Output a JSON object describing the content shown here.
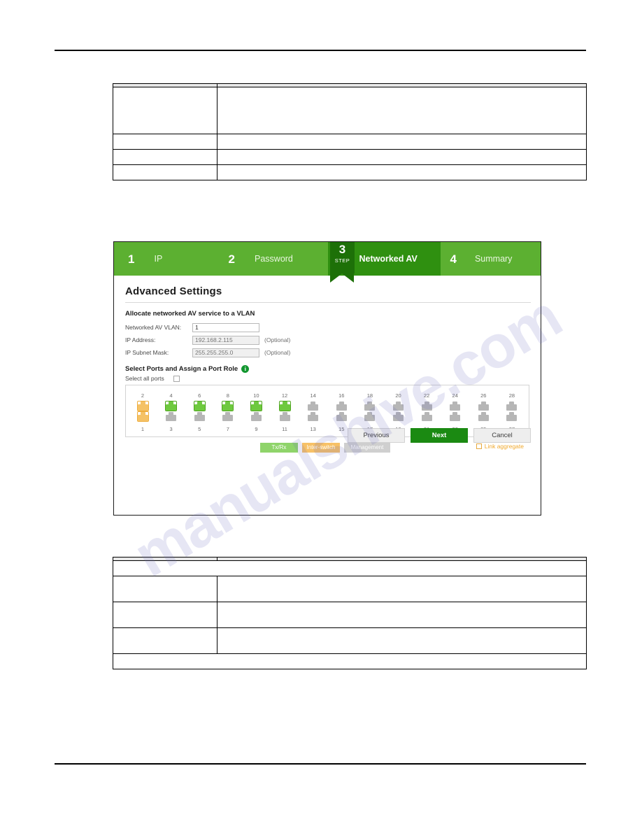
{
  "wizard": {
    "steps": [
      {
        "num": "1",
        "label": "IP",
        "active": false
      },
      {
        "num": "2",
        "label": "Password",
        "active": false
      },
      {
        "num": "3",
        "label": "Networked AV",
        "active": true
      },
      {
        "num": "4",
        "label": "Summary",
        "active": false
      }
    ],
    "pointer": {
      "num": "3",
      "word": "STEP"
    },
    "panel_title": "Advanced Settings",
    "vlan_section": {
      "heading": "Allocate networked AV service to a VLAN",
      "fields": [
        {
          "label": "Networked AV VLAN:",
          "value": "1",
          "placeholder": "",
          "disabled": false,
          "optional": ""
        },
        {
          "label": "IP Address:",
          "value": "",
          "placeholder": "192.168.2.115",
          "disabled": true,
          "optional": "(Optional)"
        },
        {
          "label": "IP Subnet Mask:",
          "value": "",
          "placeholder": "255.255.255.0",
          "disabled": true,
          "optional": "(Optional)"
        }
      ]
    },
    "ports_section": {
      "heading": "Select Ports and Assign a Port Role",
      "info_icon": "info-icon",
      "select_all_label": "Select all ports",
      "top_row_numbers": [
        "2",
        "4",
        "6",
        "8",
        "10",
        "12",
        "14",
        "16",
        "18",
        "20",
        "22",
        "24",
        "26",
        "28"
      ],
      "bottom_row_numbers": [
        "1",
        "3",
        "5",
        "7",
        "9",
        "11",
        "13",
        "15",
        "17",
        "19",
        "21",
        "23",
        "25",
        "27"
      ],
      "top_row_states": [
        "orange",
        "green",
        "green",
        "green",
        "green",
        "green",
        "gray",
        "gray",
        "gray",
        "gray",
        "gray",
        "gray",
        "gray",
        "gray"
      ],
      "bottom_row_states": [
        "orange",
        "gray",
        "gray",
        "gray",
        "gray",
        "gray",
        "gray",
        "gray",
        "gray",
        "gray",
        "gray",
        "gray",
        "gray",
        "gray"
      ],
      "roles": [
        {
          "label": "Tx/Rx",
          "color": "#8fd46a"
        },
        {
          "label": "Inter-switch",
          "color": "#f7c167"
        },
        {
          "label": "Management",
          "color": "#cfcfcf"
        }
      ],
      "link_aggregate_label": "Link aggregate"
    },
    "footer": {
      "previous": "Previous",
      "next": "Next",
      "cancel": "Cancel"
    }
  },
  "tables": {
    "top": {
      "header": [
        "",
        ""
      ],
      "rows": [
        [
          "",
          ""
        ],
        [
          "",
          ""
        ],
        [
          "",
          ""
        ],
        [
          "",
          ""
        ]
      ]
    },
    "bottom": {
      "header": [
        "",
        ""
      ],
      "rows": [
        [
          "",
          ""
        ],
        [
          "",
          ""
        ],
        [
          "",
          ""
        ],
        [
          "",
          ""
        ]
      ]
    }
  },
  "watermark": {
    "line1": "manualshive.com"
  }
}
